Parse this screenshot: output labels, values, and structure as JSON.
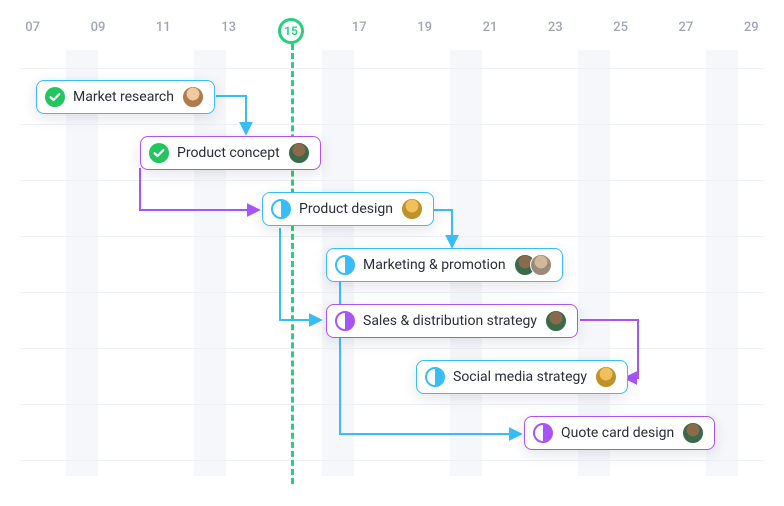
{
  "timeline": {
    "ticks": [
      "07",
      "09",
      "11",
      "13",
      "15",
      "17",
      "19",
      "21",
      "23",
      "25",
      "27",
      "29"
    ],
    "today_label": "15"
  },
  "tasks": {
    "t1": {
      "label": "Market research",
      "avatar_bg": "#e7b07e",
      "avatar_fg": "#8a5a2a"
    },
    "t2": {
      "label": "Product concept",
      "avatar_bg": "#4a8a5a",
      "avatar_fg": "#2a5a3a"
    },
    "t3": {
      "label": "Product design",
      "avatar_bg": "#f0c05a",
      "avatar_fg": "#9a7a2a"
    },
    "t4": {
      "label": "Marketing & promotion",
      "avatar_bg": "#4a8a5a",
      "avatar_bg2": "#c0a88a"
    },
    "t5": {
      "label": "Sales & distribution strategy",
      "avatar_bg": "#4a8a5a"
    },
    "t6": {
      "label": "Social media strategy",
      "avatar_bg": "#f0c05a"
    },
    "t7": {
      "label": "Quote card design",
      "avatar_bg": "#4a8a5a"
    }
  },
  "chart_data": {
    "type": "gantt",
    "x_unit": "day_of_month",
    "today": 15,
    "x_range": [
      7,
      29
    ],
    "rows": [
      {
        "id": "t1",
        "label": "Market research",
        "start": 7,
        "status": "done",
        "color": "blue",
        "avatars": 1,
        "depends_on": []
      },
      {
        "id": "t2",
        "label": "Product concept",
        "start": 11,
        "status": "done",
        "color": "purple",
        "avatars": 1,
        "depends_on": [
          "t1"
        ]
      },
      {
        "id": "t3",
        "label": "Product design",
        "start": 14,
        "status": "half",
        "color": "blue",
        "avatars": 1,
        "depends_on": [
          "t2"
        ]
      },
      {
        "id": "t4",
        "label": "Marketing & promotion",
        "start": 16,
        "status": "half",
        "color": "blue",
        "avatars": 2,
        "depends_on": [
          "t3"
        ]
      },
      {
        "id": "t5",
        "label": "Sales & distribution strategy",
        "start": 16,
        "status": "half",
        "color": "purple",
        "avatars": 1,
        "depends_on": [
          "t3"
        ]
      },
      {
        "id": "t6",
        "label": "Social media strategy",
        "start": 19,
        "status": "half",
        "color": "blue",
        "avatars": 1,
        "depends_on": [
          "t5"
        ]
      },
      {
        "id": "t7",
        "label": "Quote card design",
        "start": 22,
        "status": "half",
        "color": "purple",
        "avatars": 1,
        "depends_on": [
          "t4",
          "t6"
        ]
      }
    ]
  }
}
